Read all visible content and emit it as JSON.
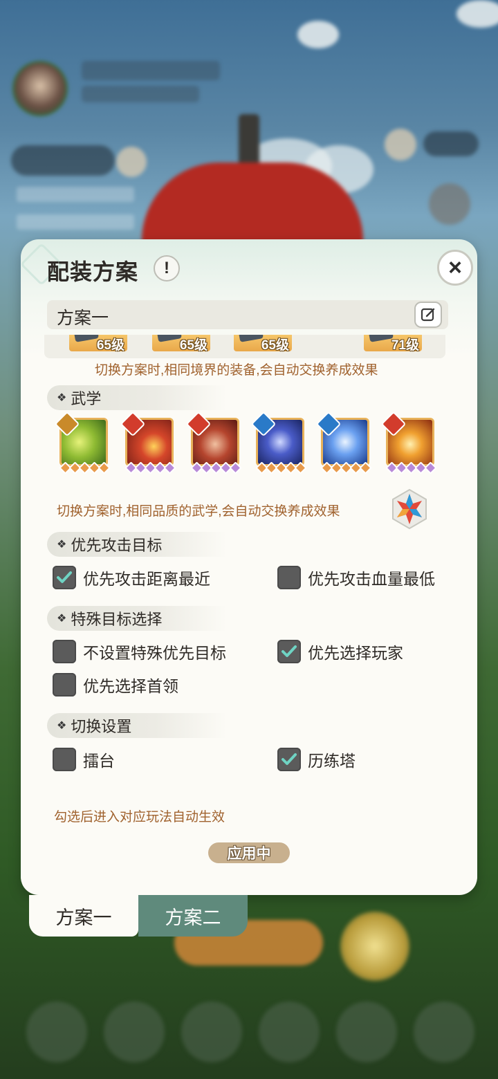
{
  "panel": {
    "title": "配装方案",
    "info_icon": "!",
    "close_icon": "×",
    "current_scheme": "方案一",
    "equipment_levels": [
      "65级",
      "65级",
      "65级",
      "71级"
    ],
    "equipment_note": "切换方案时,相同境界的装备,会自动交换养成效果",
    "martial_section": "武学",
    "martial_note": "切换方案时,相同品质的武学,会自动交换养成效果",
    "skills": [
      {
        "icon": "sword-skill-icon",
        "badge": "sword-badge"
      },
      {
        "icon": "fire-orb-skill-icon",
        "badge": "fire-badge"
      },
      {
        "icon": "fist-skill-icon",
        "badge": "fire-badge"
      },
      {
        "icon": "spirit-skill-icon",
        "badge": "water-badge"
      },
      {
        "icon": "lightning-palm-skill-icon",
        "badge": "water-badge"
      },
      {
        "icon": "flame-palm-skill-icon",
        "badge": "fire-badge"
      }
    ],
    "attack_section": "优先攻击目标",
    "attack_options": [
      {
        "label": "优先攻击距离最近",
        "checked": true
      },
      {
        "label": "优先攻击血量最低",
        "checked": false
      }
    ],
    "special_section": "特殊目标选择",
    "special_options": [
      {
        "label": "不设置特殊优先目标",
        "checked": false
      },
      {
        "label": "优先选择玩家",
        "checked": true
      },
      {
        "label": "优先选择首领",
        "checked": false
      }
    ],
    "switch_section": "切换设置",
    "switch_options": [
      {
        "label": "擂台",
        "checked": false
      },
      {
        "label": "历练塔",
        "checked": true
      }
    ],
    "switch_note": "勾选后进入对应玩法自动生效",
    "applied_label": "应用中"
  },
  "tabs": [
    "方案一",
    "方案二"
  ],
  "colors": {
    "panel_bg": "#fcfbf6",
    "note_text": "#a0622e",
    "checkbox": "#5b5b5b",
    "check_mark": "#6fd3c3",
    "active_tab": "#5f8a7c",
    "applied_pill": "#c8b08e"
  }
}
